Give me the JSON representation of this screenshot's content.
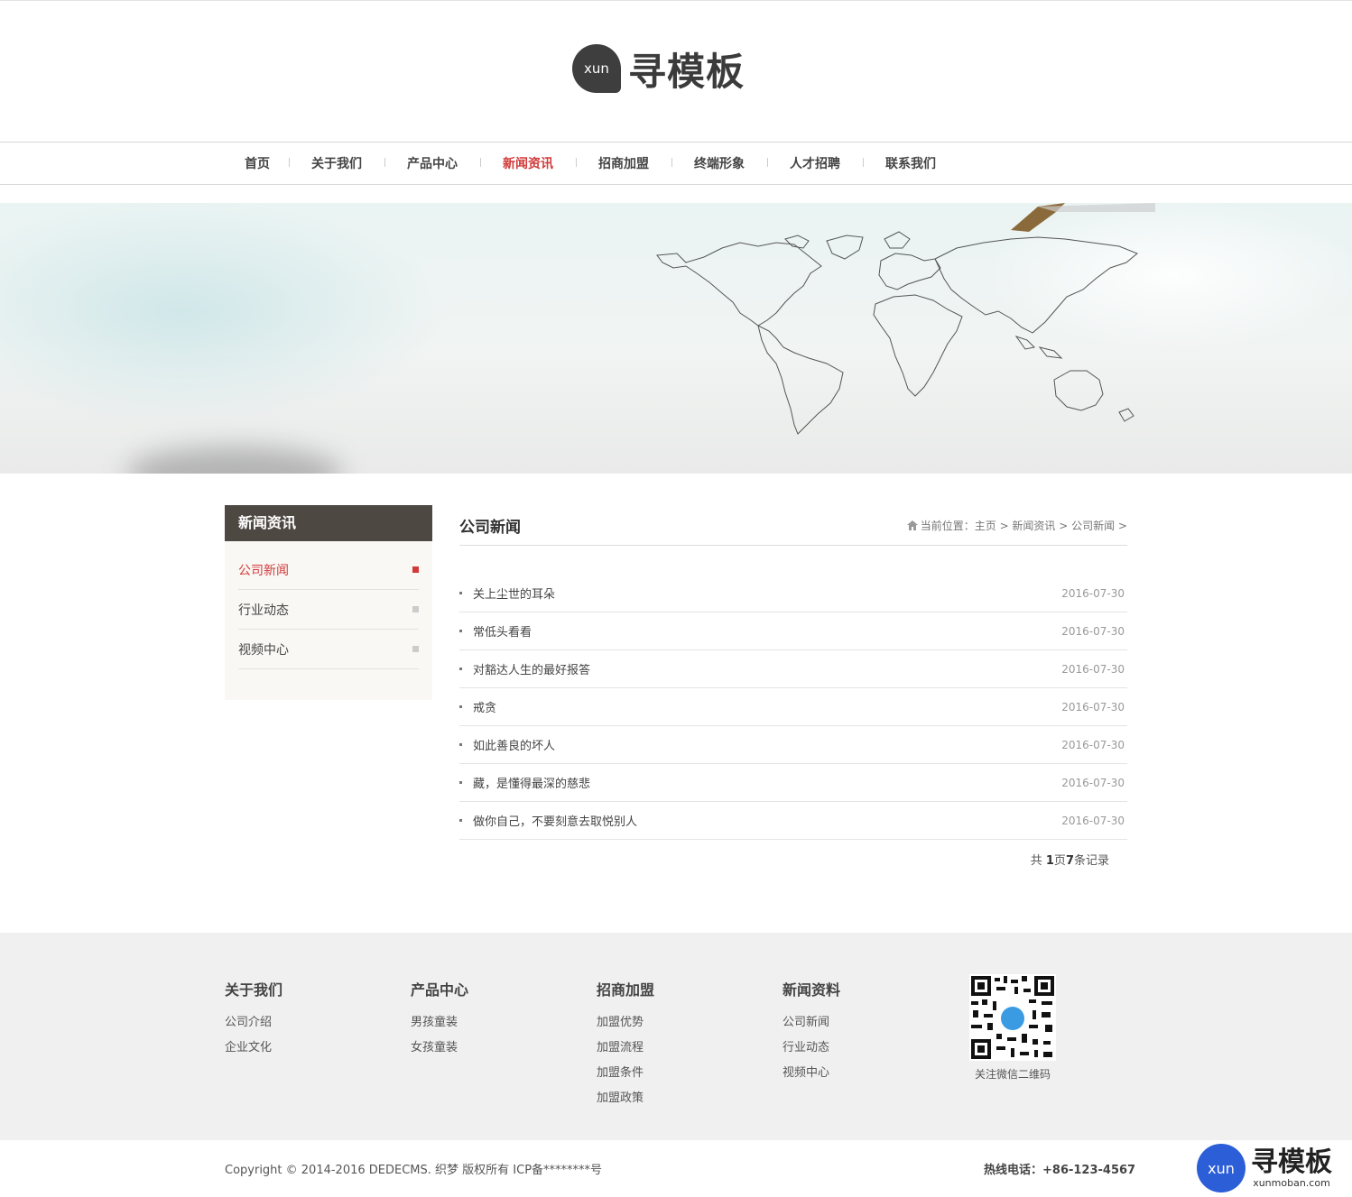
{
  "header": {
    "logo_mark": "xun",
    "logo_text": "寻模板"
  },
  "nav": {
    "items": [
      {
        "label": "首页"
      },
      {
        "label": "关于我们"
      },
      {
        "label": "产品中心"
      },
      {
        "label": "新闻资讯"
      },
      {
        "label": "招商加盟"
      },
      {
        "label": "终端形象"
      },
      {
        "label": "人才招聘"
      },
      {
        "label": "联系我们"
      }
    ],
    "active": "新闻资讯"
  },
  "sidebar": {
    "title": "新闻资讯",
    "items": [
      {
        "label": "公司新闻"
      },
      {
        "label": "行业动态"
      },
      {
        "label": "视频中心"
      }
    ],
    "active": "公司新闻"
  },
  "main": {
    "title": "公司新闻",
    "breadcrumb": "当前位置：主页 > 新闻资讯 > 公司新闻 >",
    "news": [
      {
        "title": "关上尘世的耳朵",
        "date": "2016-07-30"
      },
      {
        "title": "常低头看看",
        "date": "2016-07-30"
      },
      {
        "title": "对豁达人生的最好报答",
        "date": "2016-07-30"
      },
      {
        "title": "戒贪",
        "date": "2016-07-30"
      },
      {
        "title": "如此善良的坏人",
        "date": "2016-07-30"
      },
      {
        "title": "藏，是懂得最深的慈悲",
        "date": "2016-07-30"
      },
      {
        "title": "做你自己，不要刻意去取悦别人",
        "date": "2016-07-30"
      }
    ],
    "pager": {
      "prefix": "共 ",
      "pages": "1",
      "mid": "页",
      "records": "7",
      "suffix": "条记录"
    }
  },
  "footer": {
    "columns": [
      {
        "title": "关于我们",
        "links": [
          "公司介绍",
          "企业文化"
        ]
      },
      {
        "title": "产品中心",
        "links": [
          "男孩童装",
          "女孩童装"
        ]
      },
      {
        "title": "招商加盟",
        "links": [
          "加盟优势",
          "加盟流程",
          "加盟条件",
          "加盟政策"
        ]
      },
      {
        "title": "新闻资料",
        "links": [
          "公司新闻",
          "行业动态",
          "视频中心"
        ]
      }
    ],
    "qr_caption": "关注微信二维码",
    "copyright": "Copyright © 2014-2016 DEDECMS. 织梦 版权所有  ICP备********号",
    "hotline": "热线电话：+86-123-4567"
  },
  "watermark": {
    "mark": "xun",
    "big": "寻模板",
    "small": "xunmoban.com"
  },
  "colors": {
    "accent": "#d23a3a",
    "sidebar_header": "#4e4843",
    "footer_bg": "#f0f0f0"
  }
}
